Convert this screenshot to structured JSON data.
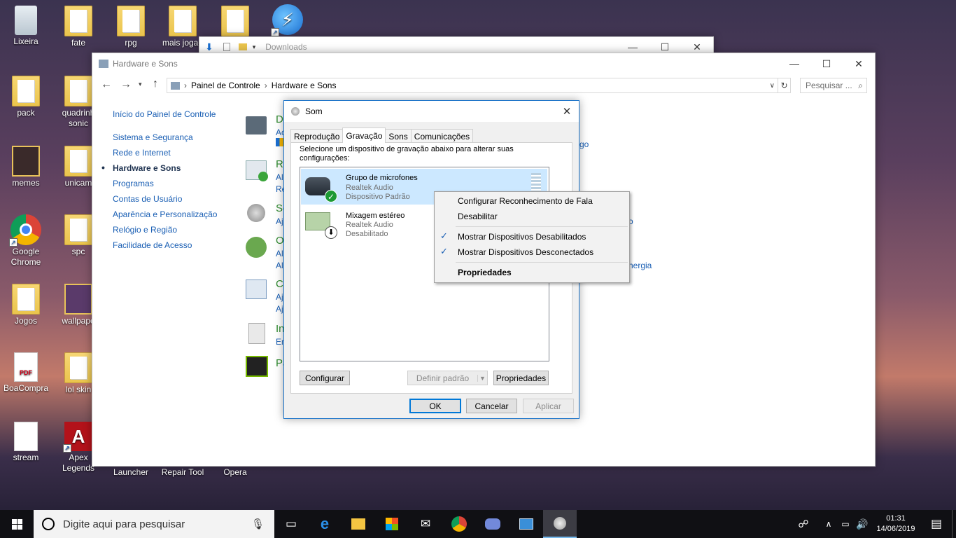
{
  "desktop": {
    "icons": [
      {
        "label": "Lixeira"
      },
      {
        "label": "fate"
      },
      {
        "label": "rpg"
      },
      {
        "label": "mais jogad"
      },
      {
        "label": "pack"
      },
      {
        "label": "quadrinh sonic"
      },
      {
        "label": "memes"
      },
      {
        "label": "unicam"
      },
      {
        "label": "Google Chrome"
      },
      {
        "label": "spc"
      },
      {
        "label": "Jogos"
      },
      {
        "label": "wallpape"
      },
      {
        "label": "BoaCompra"
      },
      {
        "label": "lol skin"
      },
      {
        "label": "stream"
      },
      {
        "label": "Apex Legends"
      },
      {
        "label": "Launcher"
      },
      {
        "label": "Repair Tool"
      },
      {
        "label": "Opera"
      }
    ]
  },
  "downloads_window": {
    "title": "Downloads"
  },
  "control_panel": {
    "title": "Hardware e Sons",
    "breadcrumb": [
      "Painel de Controle",
      "Hardware e Sons"
    ],
    "search_placeholder": "Pesquisar ...",
    "nav": [
      {
        "label": "Início do Painel de Controle"
      },
      {
        "label": "Sistema e Segurança"
      },
      {
        "label": "Rede e Internet"
      },
      {
        "label": "Hardware e Sons",
        "current": true
      },
      {
        "label": "Programas"
      },
      {
        "label": "Contas de Usuário"
      },
      {
        "label": "Aparência e Personalização"
      },
      {
        "label": "Relógio e Região"
      },
      {
        "label": "Facilidade de Acesso"
      }
    ],
    "categories": [
      {
        "title": "D",
        "links": [
          "Ac"
        ]
      },
      {
        "title": "R",
        "links": [
          "Al",
          "Re"
        ]
      },
      {
        "title": "So",
        "links": [
          "Aj"
        ]
      },
      {
        "title": "O",
        "links": [
          "Al",
          "Al"
        ]
      },
      {
        "title": "Co",
        "links": [
          "Aj",
          "Aj"
        ]
      },
      {
        "title": "In",
        "links": [
          "En"
        ]
      },
      {
        "title": "Pa",
        "links": []
      }
    ],
    "right_fragments": [
      "go",
      "o",
      "nergia"
    ]
  },
  "sound_dialog": {
    "title": "Som",
    "tabs": [
      "Reprodução",
      "Gravação",
      "Sons",
      "Comunicações"
    ],
    "active_tab": "Gravação",
    "instruction": "Selecione um dispositivo de gravação abaixo para alterar suas configurações:",
    "devices": [
      {
        "name": "Grupo de microfones",
        "driver": "Realtek Audio",
        "status": "Dispositivo Padrão"
      },
      {
        "name": "Mixagem estéreo",
        "driver": "Realtek Audio",
        "status": "Desabilitado"
      }
    ],
    "buttons": {
      "configure": "Configurar",
      "set_default": "Definir padrão",
      "properties": "Propriedades",
      "ok": "OK",
      "cancel": "Cancelar",
      "apply": "Aplicar"
    }
  },
  "context_menu": {
    "items": [
      {
        "label": "Configurar Reconhecimento de Fala"
      },
      {
        "label": "Desabilitar"
      },
      {
        "label": "Mostrar Dispositivos Desabilitados",
        "checked": true
      },
      {
        "label": "Mostrar Dispositivos Desconectados",
        "checked": true
      },
      {
        "label": "Propriedades",
        "bold": true
      }
    ]
  },
  "taskbar": {
    "search_placeholder": "Digite aqui para pesquisar",
    "time": "01:31",
    "date": "14/06/2019"
  },
  "colors": {
    "accent": "#0078d7",
    "link": "#1a5fb4",
    "cp_title_green": "#2f8a2f",
    "taskbar": "#101014"
  }
}
